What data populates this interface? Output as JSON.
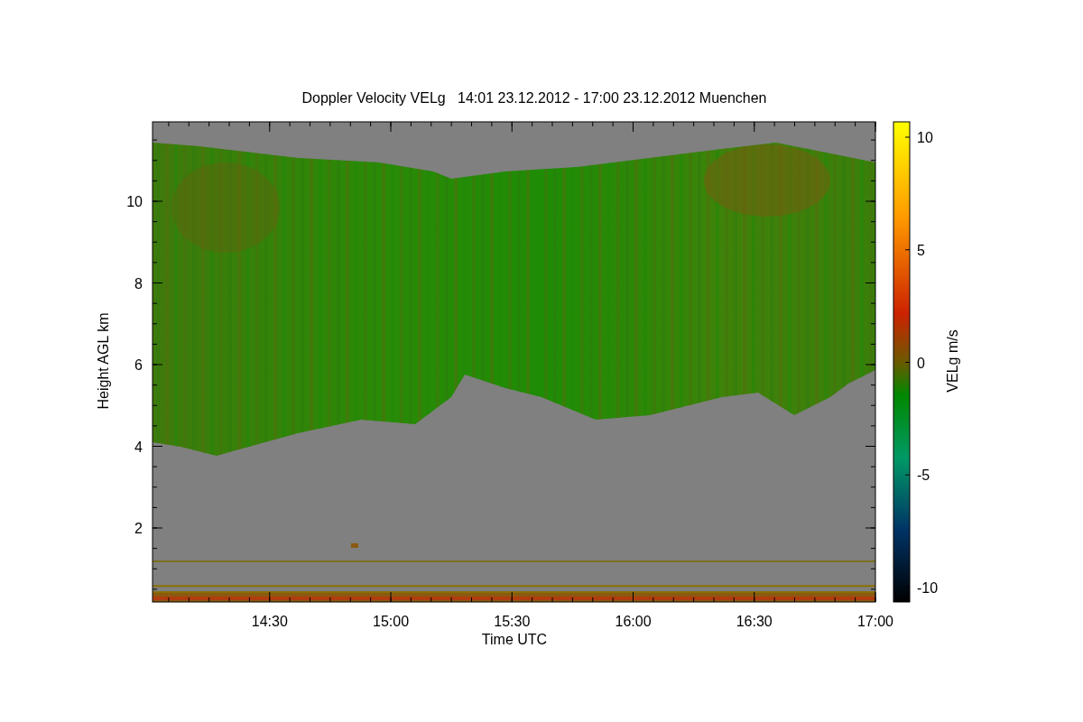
{
  "figure": {
    "title": "Doppler Velocity VELg   14:01 23.12.2012 - 17:00 23.12.2012 Muenchen",
    "xlabel": "Time UTC",
    "ylabel": "Height AGL km",
    "xticks": [
      "14:30",
      "15:00",
      "15:30",
      "16:00",
      "16:30",
      "17:00"
    ],
    "yticks": [
      "10",
      "8",
      "6",
      "4",
      "2"
    ],
    "colorbar": {
      "label": "VELg m/s",
      "ticks": [
        "10",
        "5",
        "0",
        "-5",
        "-10"
      ]
    }
  }
}
